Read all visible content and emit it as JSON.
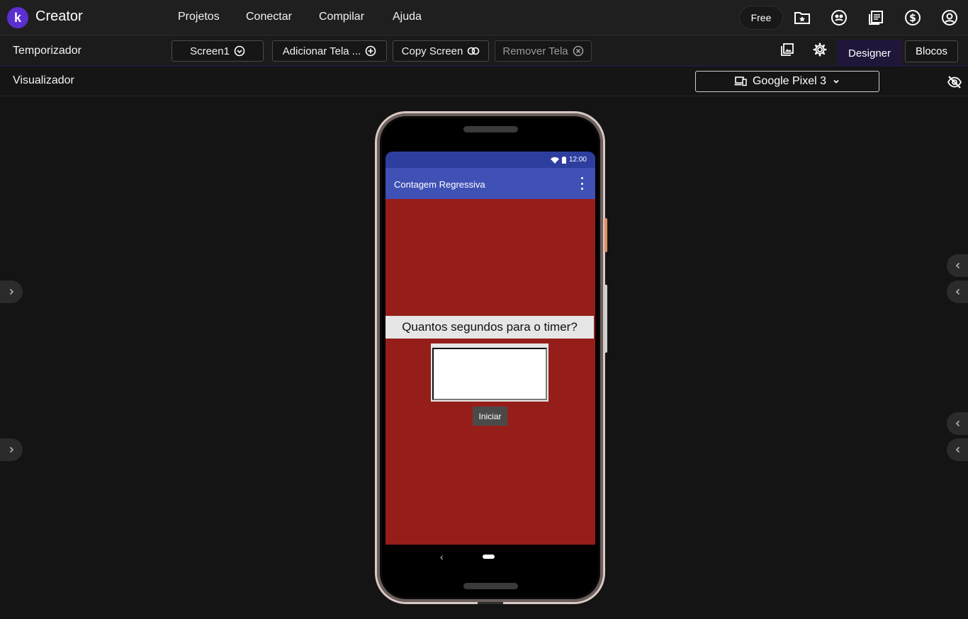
{
  "app": {
    "logo_letter": "k",
    "brand": "Creator"
  },
  "nav": {
    "items": [
      "Projetos",
      "Conectar",
      "Compilar",
      "Ajuda"
    ]
  },
  "header_right": {
    "plan": "Free",
    "icons": [
      "new-project-icon",
      "gallery-icon",
      "guide-icon",
      "donate-icon",
      "account-icon"
    ]
  },
  "toolbar": {
    "project_name": "Temporizador",
    "screen_select": "Screen1",
    "add_screen": "Adicionar Tela ...",
    "copy_screen": "Copy Screen",
    "remove_screen": "Remover Tela",
    "designer": "Designer",
    "blocks": "Blocos"
  },
  "visualizer": {
    "title": "Visualizador",
    "device": "Google Pixel 3"
  },
  "phone": {
    "status_time": "12:00",
    "app_title": "Contagem Regressiva",
    "question": "Quantos segundos para o timer?",
    "input_value": "",
    "start_button": "Iniciar",
    "back_glyph": "‹"
  },
  "colors": {
    "accent": "#5b2fd1",
    "appbar": "#3f51b5",
    "statusbar": "#2e3e9f",
    "screen_bg": "#961e1a",
    "designer_active": "#20163a"
  }
}
